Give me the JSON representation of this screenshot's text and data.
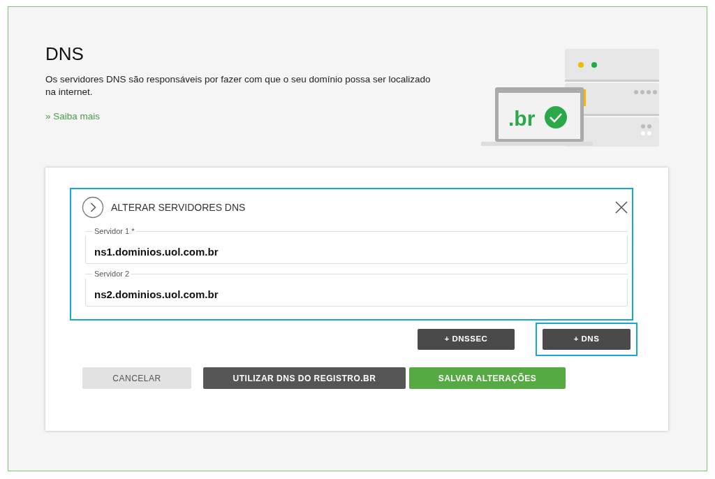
{
  "header": {
    "title": "DNS",
    "description": "Os servidores DNS são responsáveis por fazer com que o seu domínio possa ser localizado na internet.",
    "link": "» Saiba mais"
  },
  "illustration": {
    "logo_text": ".br"
  },
  "panel": {
    "title": "ALTERAR SERVIDORES DNS",
    "highlighted": true,
    "fields": [
      {
        "label": "Servidor 1 *",
        "value": "ns1.dominios.uol.com.br"
      },
      {
        "label": "Servidor 2",
        "value": "ns2.dominios.uol.com.br"
      }
    ]
  },
  "add_buttons": [
    {
      "label": "+ DNSSEC",
      "highlighted": false
    },
    {
      "label": "+ DNS",
      "highlighted": true
    }
  ],
  "actions": [
    {
      "label": "CANCELAR",
      "kind": "light"
    },
    {
      "label": "UTILIZAR DNS DO REGISTRO.BR",
      "kind": "dark"
    },
    {
      "label": "SALVAR ALTERAÇÕES",
      "kind": "success"
    }
  ]
}
